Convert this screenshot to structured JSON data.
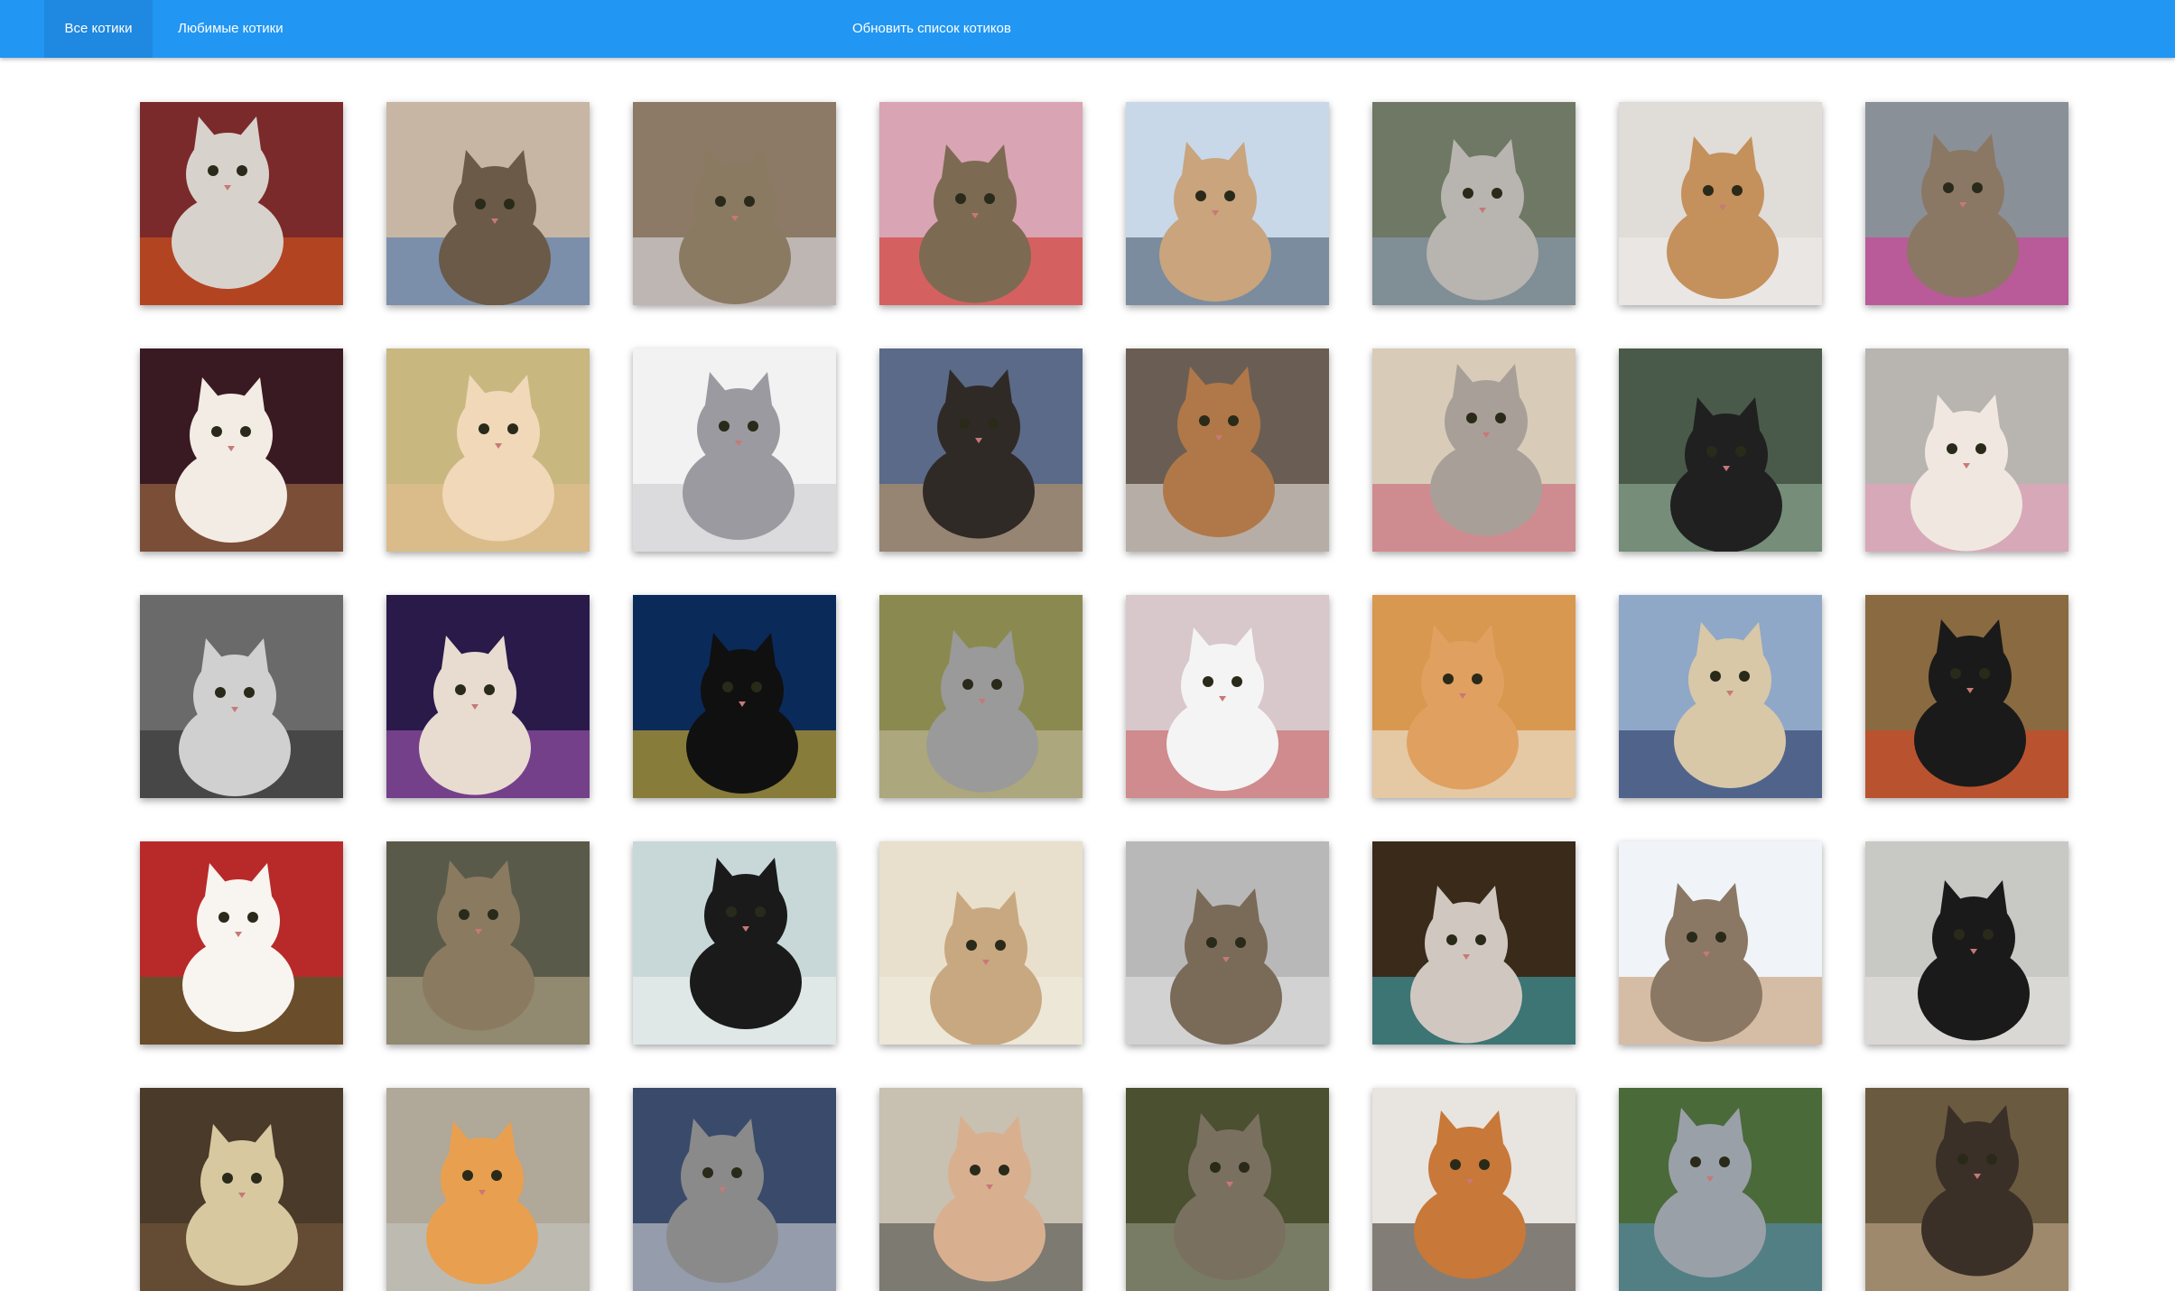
{
  "nav": {
    "tab_all": "Все котики",
    "tab_favorites": "Любимые котики",
    "refresh": "Обновить список котиков"
  },
  "theme": {
    "primary": "#2196f3",
    "active_tab": "#1f88e0",
    "background": "#ffffff"
  },
  "cat_photos": [
    {
      "bg": "#7a2a2a",
      "cat": "#d8d2cc",
      "accent": "#e25a1c"
    },
    {
      "bg": "#c8b6a4",
      "cat": "#6b5a48",
      "accent": "#3d6fb0"
    },
    {
      "bg": "#8c7a66",
      "cat": "#8a7a62",
      "accent": "#e8e8f0"
    },
    {
      "bg": "#d9a4b4",
      "cat": "#7d6a52",
      "accent": "#d02a1c"
    },
    {
      "bg": "#c8d8e8",
      "cat": "#c9a47c",
      "accent": "#3a4e60"
    },
    {
      "bg": "#6e7864",
      "cat": "#b8b4b0",
      "accent": "#8fa0c0"
    },
    {
      "bg": "#e0dcd8",
      "cat": "#c4905c",
      "accent": "#f0eeec"
    },
    {
      "bg": "#8a9098",
      "cat": "#8a7864",
      "accent": "#e0309a"
    },
    {
      "bg": "#3a1a22",
      "cat": "#f2ece4",
      "accent": "#b07a4a"
    },
    {
      "bg": "#c8b880",
      "cat": "#f0d8b8",
      "accent": "#e8c090"
    },
    {
      "bg": "#f2f2f2",
      "cat": "#9a9aa0",
      "accent": "#c8c8cc"
    },
    {
      "bg": "#5a6a88",
      "cat": "#302a26",
      "accent": "#c89a60"
    },
    {
      "bg": "#6a5e54",
      "cat": "#b07848",
      "accent": "#f4f0ea"
    },
    {
      "bg": "#d8ccb8",
      "cat": "#a8a098",
      "accent": "#c85870"
    },
    {
      "bg": "#4a5a4a",
      "cat": "#202020",
      "accent": "#9ab8a0"
    },
    {
      "bg": "#b8b4b0",
      "cat": "#f0e8e0",
      "accent": "#f0a0c0"
    },
    {
      "bg": "#6a6a6a",
      "cat": "#d0d0d0",
      "accent": "#2a2a2a"
    },
    {
      "bg": "#2a1a4a",
      "cat": "#e8dcd0",
      "accent": "#b060c0"
    },
    {
      "bg": "#0a2a5a",
      "cat": "#101010",
      "accent": "#f0c020"
    },
    {
      "bg": "#8a8a50",
      "cat": "#9a9a9a",
      "accent": "#c8c0a0"
    },
    {
      "bg": "#d8c8cc",
      "cat": "#f4f4f4",
      "accent": "#c85a5a"
    },
    {
      "bg": "#d89850",
      "cat": "#e0a060",
      "accent": "#f0f0ea"
    },
    {
      "bg": "#90a8c8",
      "cat": "#d8c8a8",
      "accent": "#1a2a5a"
    },
    {
      "bg": "#8a6a40",
      "cat": "#1a1a1a",
      "accent": "#e04020"
    },
    {
      "bg": "#b82a2a",
      "cat": "#f8f4f0",
      "accent": "#2a6a2a"
    },
    {
      "bg": "#5a5a4a",
      "cat": "#8a7a60",
      "accent": "#c0b090"
    },
    {
      "bg": "#c8d8d8",
      "cat": "#1a1a1a",
      "accent": "#f4f4f4"
    },
    {
      "bg": "#e8e0cc",
      "cat": "#c8a880",
      "accent": "#f0ece0"
    },
    {
      "bg": "#b8b8b8",
      "cat": "#7a6a58",
      "accent": "#e8e8e8"
    },
    {
      "bg": "#3a2a1a",
      "cat": "#d0c8c0",
      "accent": "#40b0c0"
    },
    {
      "bg": "#f0f4f8",
      "cat": "#8a7864",
      "accent": "#c09060"
    },
    {
      "bg": "#c8c8c4",
      "cat": "#1a1a1a",
      "accent": "#e8e6e2"
    },
    {
      "bg": "#4a3a2a",
      "cat": "#d8c8a0",
      "accent": "#7a5a3a"
    },
    {
      "bg": "#b0a898",
      "cat": "#e8a050",
      "accent": "#c8c8c8"
    },
    {
      "bg": "#3a4a6a",
      "cat": "#8a8a8a",
      "accent": "#e0e0e0"
    },
    {
      "bg": "#c8c0b0",
      "cat": "#d8b090",
      "accent": "#404040"
    },
    {
      "bg": "#4a5030",
      "cat": "#7a7060",
      "accent": "#a0a090"
    },
    {
      "bg": "#e8e4e0",
      "cat": "#c87838",
      "accent": "#302820"
    },
    {
      "bg": "#4a6a3a",
      "cat": "#9aa0a8",
      "accent": "#5a90c0"
    },
    {
      "bg": "#6a5a40",
      "cat": "#3a3028",
      "accent": "#c8b090"
    }
  ]
}
